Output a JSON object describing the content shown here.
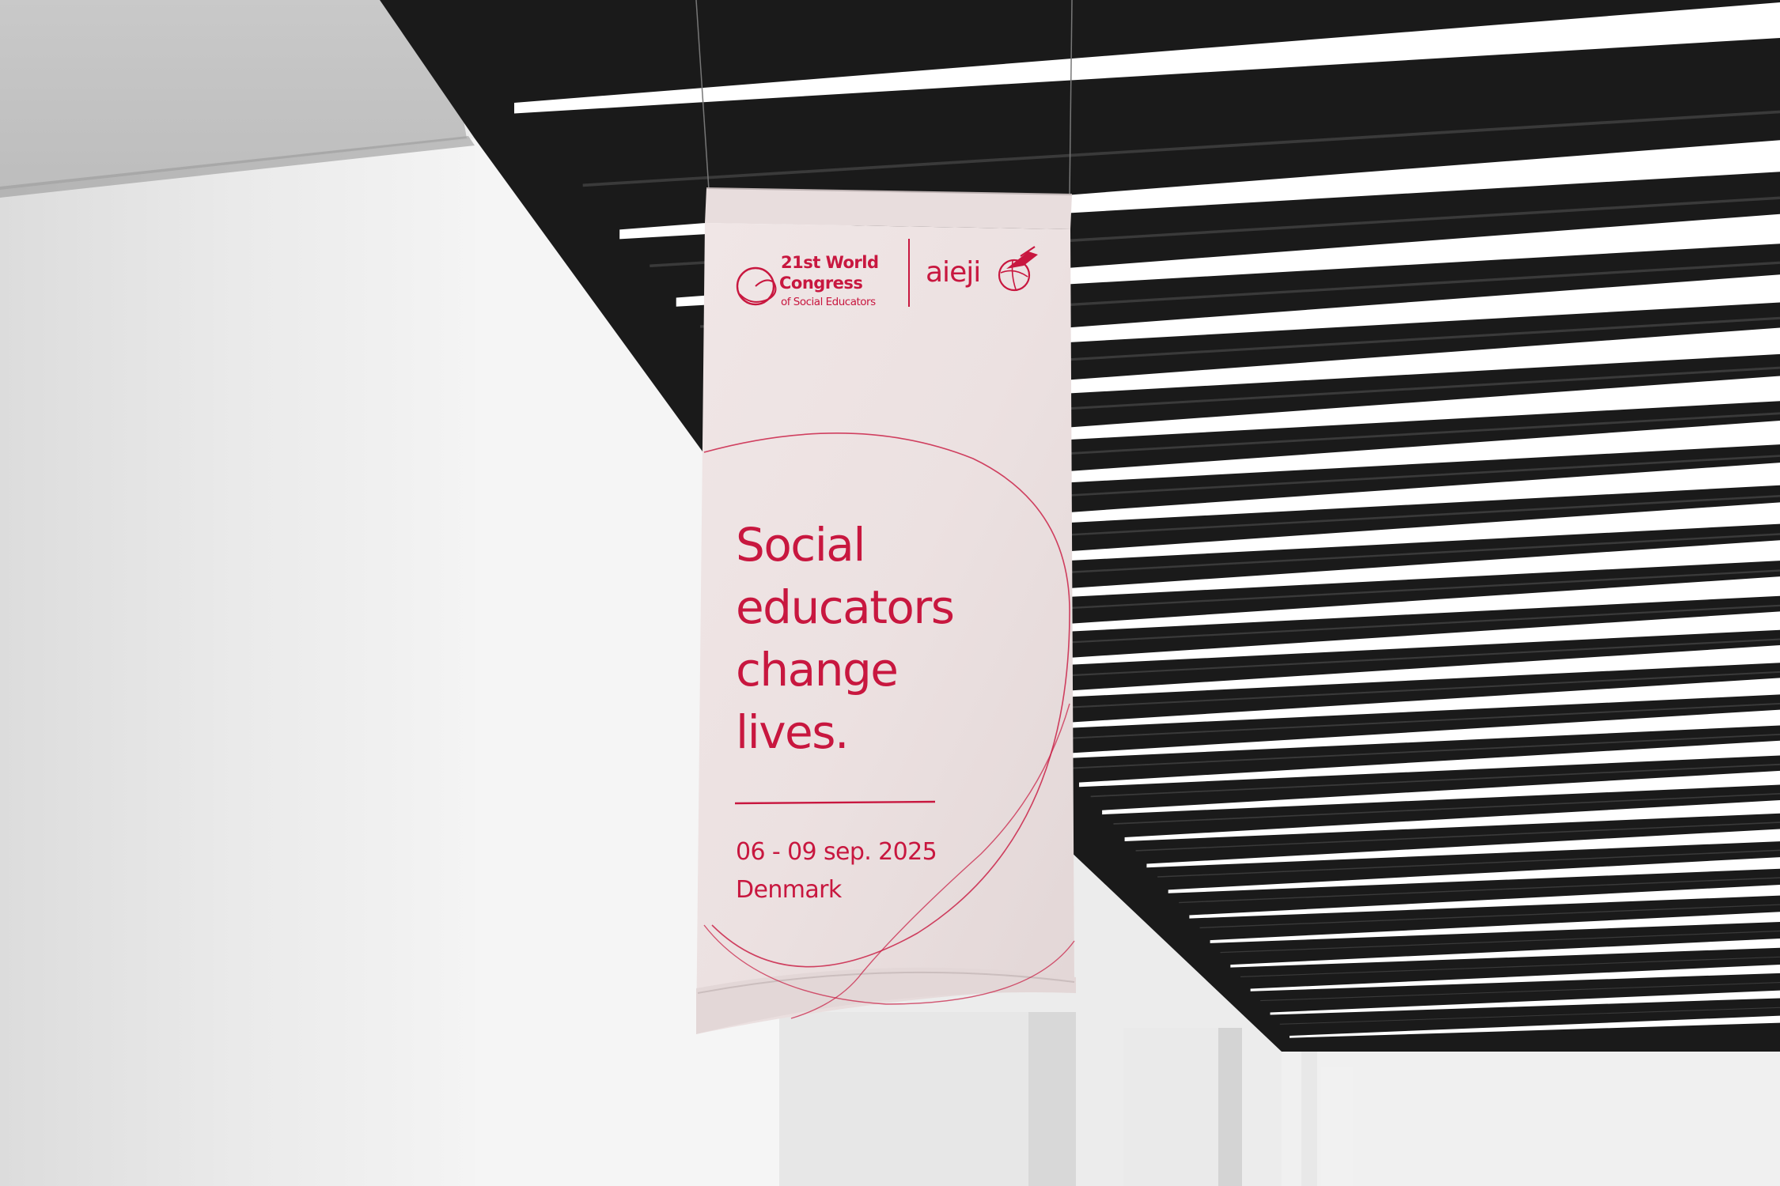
{
  "banner": {
    "congress_line1": "21st World",
    "congress_line2": "Congress",
    "congress_line3": "of Social Educators",
    "partner_logo": "aieji",
    "headline": [
      "Social",
      "educators",
      "change",
      "lives."
    ],
    "date": "06 - 09 sep. 2025",
    "location": "Denmark"
  },
  "colors": {
    "brand_red": "#c8173f",
    "banner_fabric": "#ede2e2",
    "ceiling_dark": "#1a1a1a",
    "light_tube": "#ffffff",
    "wall": "#f2f2f2"
  },
  "icons": [
    "congress-circle-logo-icon",
    "aieji-globe-bird-icon"
  ]
}
